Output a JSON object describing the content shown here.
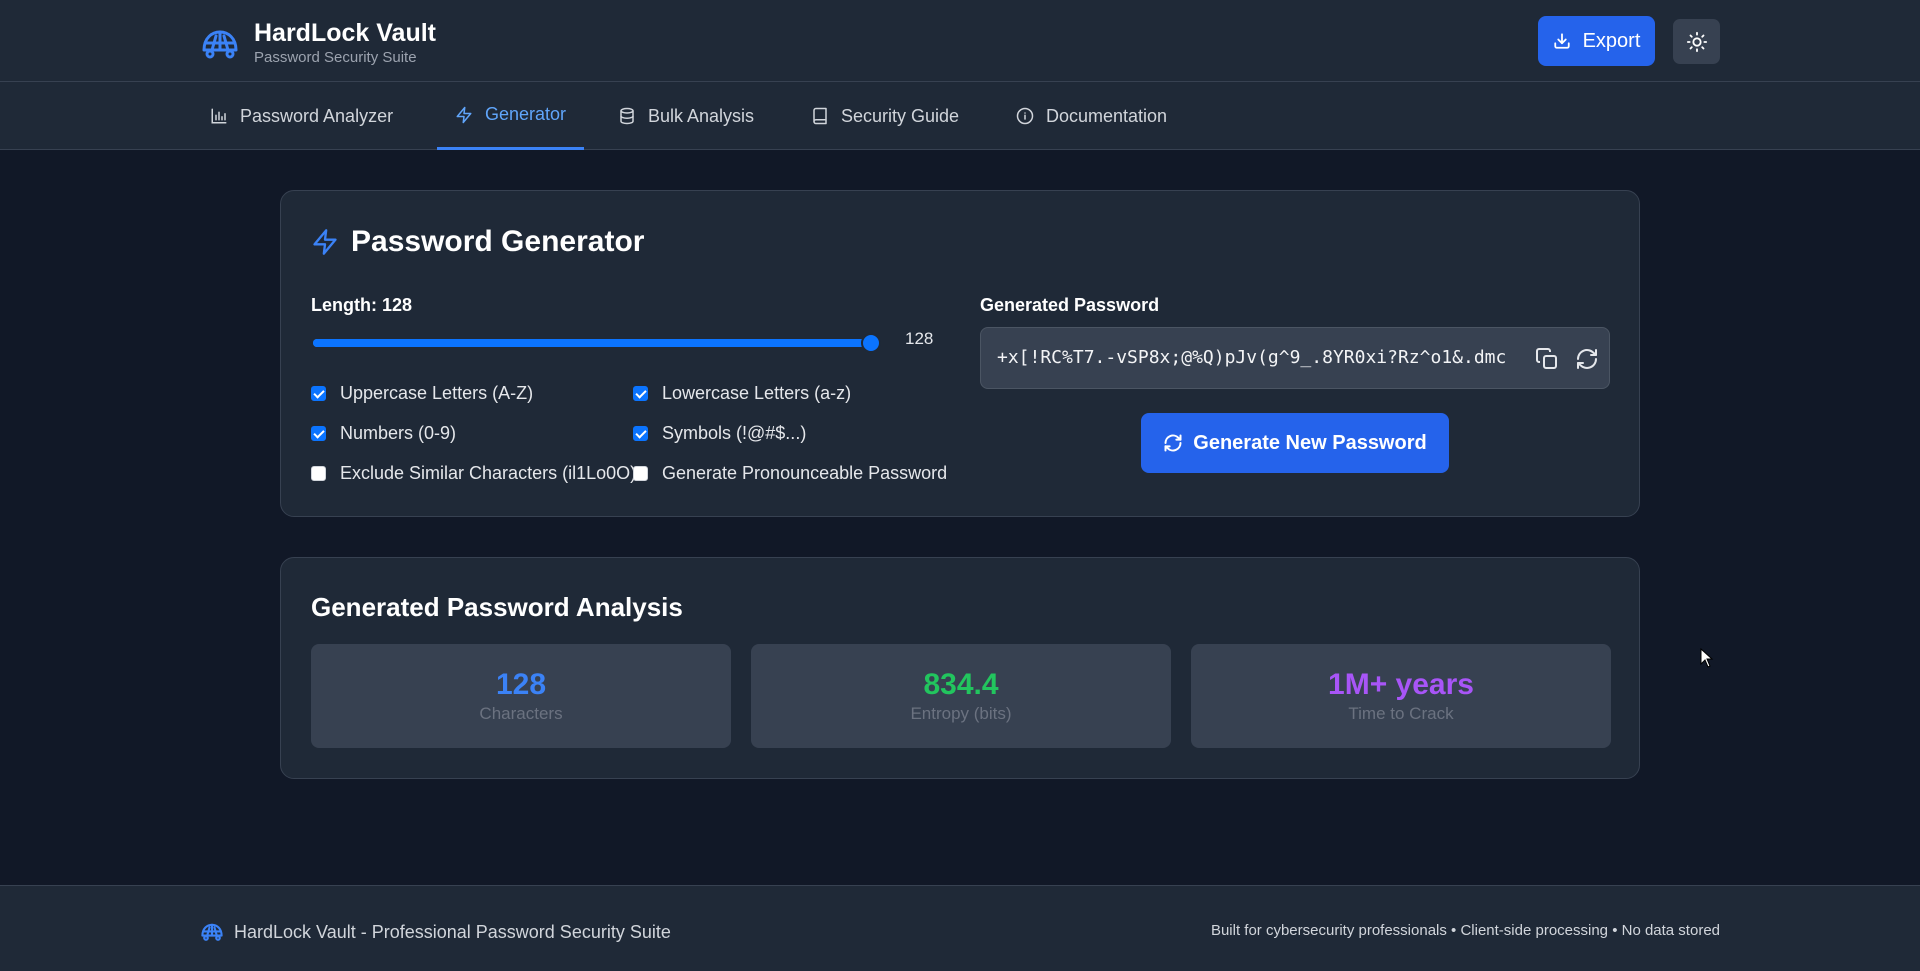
{
  "app": {
    "title": "HardLock Vault",
    "subtitle": "Password Security Suite",
    "export_label": "Export",
    "accent": "#2563eb"
  },
  "tabs": [
    {
      "label": "Password Analyzer",
      "icon": "bar-chart-icon",
      "active": false
    },
    {
      "label": "Generator",
      "icon": "zap-icon",
      "active": true
    },
    {
      "label": "Bulk Analysis",
      "icon": "database-icon",
      "active": false
    },
    {
      "label": "Security Guide",
      "icon": "book-icon",
      "active": false
    },
    {
      "label": "Documentation",
      "icon": "info-icon",
      "active": false
    }
  ],
  "generator": {
    "title": "Password Generator",
    "length_label": "Length: 128",
    "length_value": "128",
    "length_fraction": 1.0,
    "options": [
      {
        "label": "Uppercase Letters (A-Z)",
        "checked": true
      },
      {
        "label": "Lowercase Letters (a-z)",
        "checked": true
      },
      {
        "label": "Numbers (0-9)",
        "checked": true
      },
      {
        "label": "Symbols (!@#$...)",
        "checked": true
      },
      {
        "label": "Exclude Similar Characters (il1Lo0O)",
        "checked": false
      },
      {
        "label": "Generate Pronounceable Password",
        "checked": false
      }
    ],
    "output_label": "Generated Password",
    "password": "+x[!RC%T7.-vSP8x;@%Q)pJv(g^9_.8YR0xi?Rz^o1&.dmc",
    "generate_label": "Generate New Password"
  },
  "analysis": {
    "title": "Generated Password Analysis",
    "stats": [
      {
        "value": "128",
        "label": "Characters",
        "color": "#3b82f6"
      },
      {
        "value": "834.4",
        "label": "Entropy (bits)",
        "color": "#22c55e"
      },
      {
        "value": "1M+ years",
        "label": "Time to Crack",
        "color": "#a855f7"
      }
    ]
  },
  "footer": {
    "left": "HardLock Vault - Professional Password Security Suite",
    "right": "Built for cybersecurity professionals • Client-side processing • No data stored"
  }
}
